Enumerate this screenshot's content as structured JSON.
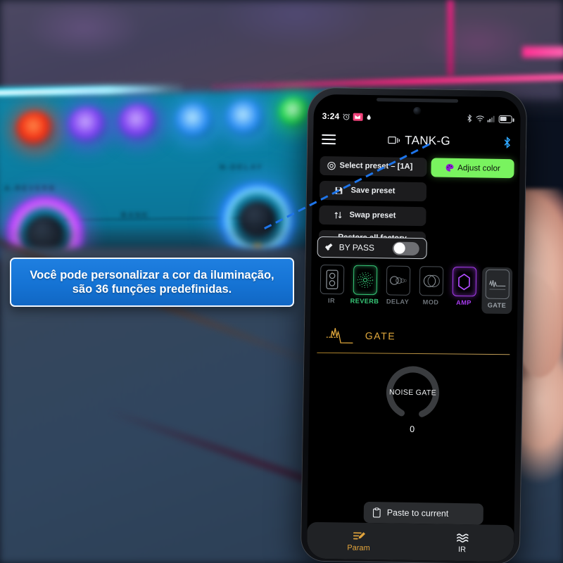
{
  "status_bar": {
    "time": "3:24",
    "left_icons": [
      "alarm-clock-icon",
      "gmail-icon",
      "drop-icon"
    ],
    "right_icons": [
      "bluetooth-icon",
      "wifi-icon",
      "cell-signal-icon",
      "battery-icon"
    ]
  },
  "app_bar": {
    "menu_icon": "hamburger-menu-icon",
    "device_icon": "cast-device-icon",
    "title": "TANK-G",
    "bluetooth_icon": "bluetooth-icon"
  },
  "presets": {
    "select_label": "Select preset – [1A]",
    "save_label": "Save preset",
    "swap_label": "Swap preset",
    "restore_label": "Restore all factory Presets",
    "adjust_color_label": "Adjust color"
  },
  "bypass": {
    "label": "BY PASS",
    "state": "on"
  },
  "effects": [
    {
      "label": "IR",
      "icon": "cabinet-icon",
      "state": "off"
    },
    {
      "label": "REVERB",
      "icon": "ripple-icon",
      "state": "on-green"
    },
    {
      "label": "DELAY",
      "icon": "echo-icon",
      "state": "off"
    },
    {
      "label": "MOD",
      "icon": "phase-icon",
      "state": "off"
    },
    {
      "label": "AMP",
      "icon": "amp-icon",
      "state": "on-purple"
    },
    {
      "label": "GATE",
      "icon": "gate-icon",
      "state": "selected"
    }
  ],
  "module": {
    "title": "GATE",
    "icon": "gate-waveform-icon",
    "knob": {
      "name": "NOISE GATE",
      "value": "0"
    }
  },
  "paste": {
    "label": "Paste to current",
    "icon": "clipboard-icon"
  },
  "bottom_nav": [
    {
      "label": "Param",
      "icon": "sliders-pencil-icon",
      "active": true
    },
    {
      "label": "IR",
      "icon": "waves-icon",
      "active": false
    }
  ],
  "callout": {
    "line1": "Você pode personalizar a cor da iluminação,",
    "line2": "são 36 funções predefinidas."
  },
  "colors": {
    "accent_green": "#79F35F",
    "accent_amber": "#E0A83C",
    "accent_purple": "#A83CF0",
    "accent_reverb": "#37C978",
    "callout_blue": "#1573D4",
    "arrow_blue": "#1E74E8",
    "bluetooth_blue": "#2FA8FF"
  }
}
